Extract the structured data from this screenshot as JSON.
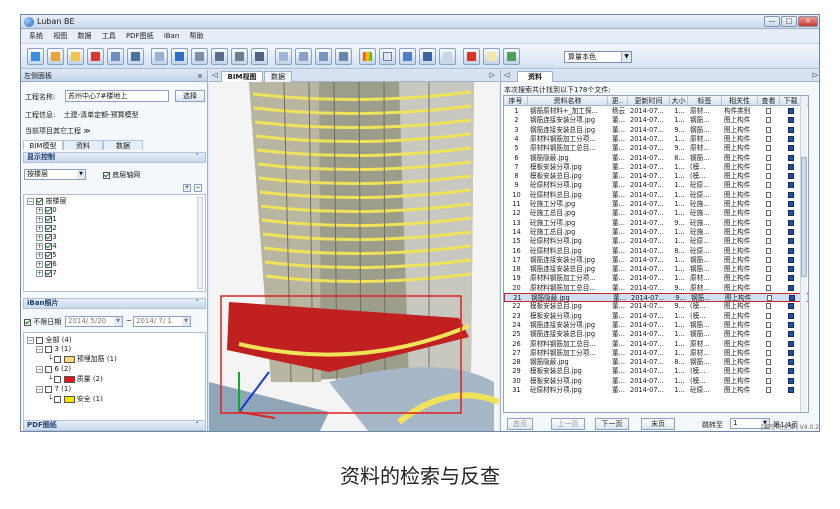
{
  "app": {
    "title": "Luban BE",
    "win_buttons": [
      "—",
      "□",
      "×"
    ]
  },
  "menu": [
    "系统",
    "视图",
    "数据",
    "工具",
    "PDF图纸",
    "iBan",
    "帮助"
  ],
  "toolbar": {
    "select_value": "算量本色",
    "icons": [
      "import-icon",
      "up-icon",
      "folder-icon",
      "pdf-icon",
      "list-icon",
      "grid-icon",
      "hand-icon",
      "fit-icon",
      "view-icon",
      "view2-icon",
      "view3-icon",
      "view4-icon",
      "table-icon",
      "table2-icon",
      "table3-icon",
      "table4-icon",
      "palette-icon",
      "doc-icon",
      "chart-icon",
      "bars-icon",
      "line-icon",
      "photo-icon",
      "note-icon",
      "photo2-icon"
    ]
  },
  "left": {
    "header": "左侧面板",
    "project_label": "工程名称:",
    "project_value": "苏州中心7#楼地上",
    "select_btn": "选择",
    "info_label": "工程信息:",
    "info_value": "土建-清单定额-预算模型",
    "other_project": "当前项目其它工程 ≫",
    "tabs": [
      "BIM模型",
      "资料",
      "数据"
    ],
    "display_control": "显示控制",
    "floor_combo": "按楼层",
    "base_grid": "底层轴网",
    "floors_root": "按楼层",
    "floors": [
      "0",
      "1",
      "2",
      "3",
      "4",
      "5",
      "6",
      "7"
    ],
    "iban_title": "iBan照片",
    "unlimited_date": "不限日期",
    "date_from": "2014/ 5/20",
    "date_to": "2014/ 7/ 1",
    "tree": [
      {
        "label": "全部 (4)"
      },
      {
        "label": "3 (1)"
      },
      {
        "label": "预埋加筋 (1)",
        "color": "#f7d97c"
      },
      {
        "label": "6 (2)"
      },
      {
        "label": "质量 (2)",
        "color": "#e0151b"
      },
      {
        "label": "7 (1)"
      },
      {
        "label": "安全 (1)",
        "color": "#f3e300"
      }
    ],
    "pdf_title": "PDF图纸"
  },
  "center": {
    "tabs": [
      "BIM视图",
      "数据"
    ]
  },
  "right": {
    "tab": "资料",
    "summary": "本次搜索共计找到以下178个文件:",
    "columns": [
      "序号",
      "资料名称",
      "更..",
      "更新时间",
      "大小",
      "标签",
      "相关性",
      "查看",
      "下载"
    ],
    "rows": [
      {
        "no": "1",
        "name": "钢筋原材料+_加工探...",
        "by": "杨云",
        "time": "2014-07...",
        "size": "1...",
        "tag": "原材...",
        "rel": "构件类别"
      },
      {
        "no": "2",
        "name": "钢筋连接安装分项.jpg",
        "by": "董...",
        "time": "2014-07...",
        "size": "1...",
        "tag": "钢筋...",
        "rel": "图上构件"
      },
      {
        "no": "3",
        "name": "钢筋连接安装总目.jpg",
        "by": "董...",
        "time": "2014-07...",
        "size": "9...",
        "tag": "钢筋...",
        "rel": "图上构件"
      },
      {
        "no": "4",
        "name": "原材料钢筋加工分项...",
        "by": "董...",
        "time": "2014-07...",
        "size": "1...",
        "tag": "原材...",
        "rel": "图上构件"
      },
      {
        "no": "5",
        "name": "原材料钢筋加工总目...",
        "by": "董...",
        "time": "2014-07...",
        "size": "9...",
        "tag": "原材...",
        "rel": "图上构件"
      },
      {
        "no": "6",
        "name": "钢筋隐蔽.jpg",
        "by": "董...",
        "time": "2014-07...",
        "size": "8...",
        "tag": "钢筋...",
        "rel": "图上构件"
      },
      {
        "no": "7",
        "name": "模板安装分项.jpg",
        "by": "董...",
        "time": "2014-07...",
        "size": "1...",
        "tag": "(模...",
        "rel": "图上构件"
      },
      {
        "no": "8",
        "name": "模板安装总目.jpg",
        "by": "董...",
        "time": "2014-07...",
        "size": "1...",
        "tag": "(模...",
        "rel": "图上构件"
      },
      {
        "no": "9",
        "name": "砼原材料分项.jpg",
        "by": "董...",
        "time": "2014-07...",
        "size": "1...",
        "tag": "砼原...",
        "rel": "图上构件"
      },
      {
        "no": "10",
        "name": "砼原材料总目.jpg",
        "by": "董...",
        "time": "2014-07...",
        "size": "1...",
        "tag": "砼原...",
        "rel": "图上构件"
      },
      {
        "no": "11",
        "name": "砼施工分项.jpg",
        "by": "董...",
        "time": "2014-07...",
        "size": "1...",
        "tag": "砼施...",
        "rel": "图上构件"
      },
      {
        "no": "12",
        "name": "砼施工总目.jpg",
        "by": "董...",
        "time": "2014-07...",
        "size": "1...",
        "tag": "砼施...",
        "rel": "图上构件"
      },
      {
        "no": "13",
        "name": "砼施工分项.jpg",
        "by": "董...",
        "time": "2014-07...",
        "size": "9...",
        "tag": "砼施...",
        "rel": "图上构件"
      },
      {
        "no": "14",
        "name": "砼施工总目.jpg",
        "by": "董...",
        "time": "2014-07...",
        "size": "1...",
        "tag": "砼施...",
        "rel": "图上构件"
      },
      {
        "no": "15",
        "name": "砼原材料分项.jpg",
        "by": "董...",
        "time": "2014-07...",
        "size": "1...",
        "tag": "砼原...",
        "rel": "图上构件"
      },
      {
        "no": "16",
        "name": "砼原材料总目.jpg",
        "by": "董...",
        "time": "2014-07...",
        "size": "8...",
        "tag": "砼原...",
        "rel": "图上构件"
      },
      {
        "no": "17",
        "name": "钢筋连接安装分项.jpg",
        "by": "董...",
        "time": "2014-07...",
        "size": "1...",
        "tag": "钢筋...",
        "rel": "图上构件"
      },
      {
        "no": "18",
        "name": "钢筋连接安装总目.jpg",
        "by": "董...",
        "time": "2014-07...",
        "size": "1...",
        "tag": "钢筋...",
        "rel": "图上构件"
      },
      {
        "no": "19",
        "name": "原材料钢筋加工分项...",
        "by": "董...",
        "time": "2014-07...",
        "size": "1...",
        "tag": "原材...",
        "rel": "图上构件"
      },
      {
        "no": "20",
        "name": "原材料钢筋加工总目...",
        "by": "董...",
        "time": "2014-07...",
        "size": "9...",
        "tag": "原材...",
        "rel": "图上构件"
      },
      {
        "no": "21",
        "name": "钢筋隐蔽.jpg",
        "by": "董...",
        "time": "2014-07...",
        "size": "9...",
        "tag": "钢筋...",
        "rel": "图上构件"
      },
      {
        "no": "22",
        "name": "模板安装总目.jpg",
        "by": "董...",
        "time": "2014-07...",
        "size": "9...",
        "tag": "(模...",
        "rel": "图上构件"
      },
      {
        "no": "23",
        "name": "模板安装分项.jpg",
        "by": "董...",
        "time": "2014-07...",
        "size": "1...",
        "tag": "(模...",
        "rel": "图上构件"
      },
      {
        "no": "24",
        "name": "钢筋连接安装分项.jpg",
        "by": "董...",
        "time": "2014-07...",
        "size": "1...",
        "tag": "钢筋...",
        "rel": "图上构件"
      },
      {
        "no": "25",
        "name": "钢筋连接安装总目.jpg",
        "by": "董...",
        "time": "2014-07...",
        "size": "1...",
        "tag": "钢筋...",
        "rel": "图上构件"
      },
      {
        "no": "26",
        "name": "原材料钢筋加工总目...",
        "by": "董...",
        "time": "2014-07...",
        "size": "1...",
        "tag": "原材...",
        "rel": "图上构件"
      },
      {
        "no": "27",
        "name": "原材料钢筋加工分项...",
        "by": "董...",
        "time": "2014-07...",
        "size": "1...",
        "tag": "原材...",
        "rel": "图上构件"
      },
      {
        "no": "28",
        "name": "钢筋隐蔽.jpg",
        "by": "董...",
        "time": "2014-07...",
        "size": "8...",
        "tag": "钢筋...",
        "rel": "图上构件"
      },
      {
        "no": "29",
        "name": "模板安装总目.jpg",
        "by": "董...",
        "time": "2014-07...",
        "size": "1...",
        "tag": "(模...",
        "rel": "图上构件"
      },
      {
        "no": "30",
        "name": "模板安装分项.jpg",
        "by": "董...",
        "time": "2014-07...",
        "size": "1...",
        "tag": "(模...",
        "rel": "图上构件"
      },
      {
        "no": "31",
        "name": "砼原材料分项.jpg",
        "by": "董...",
        "time": "2014-07...",
        "size": "1...",
        "tag": "砼原...",
        "rel": "图上构件"
      }
    ],
    "selected_row": 20,
    "pager": {
      "first": "首页",
      "prev": "上一页",
      "next": "下一页",
      "last": "末页",
      "jump": "跳转至",
      "page": "1",
      "total": "第1/4页"
    },
    "status": "[易空间,全部] V4.0.2"
  },
  "caption": "资料的检索与反查"
}
